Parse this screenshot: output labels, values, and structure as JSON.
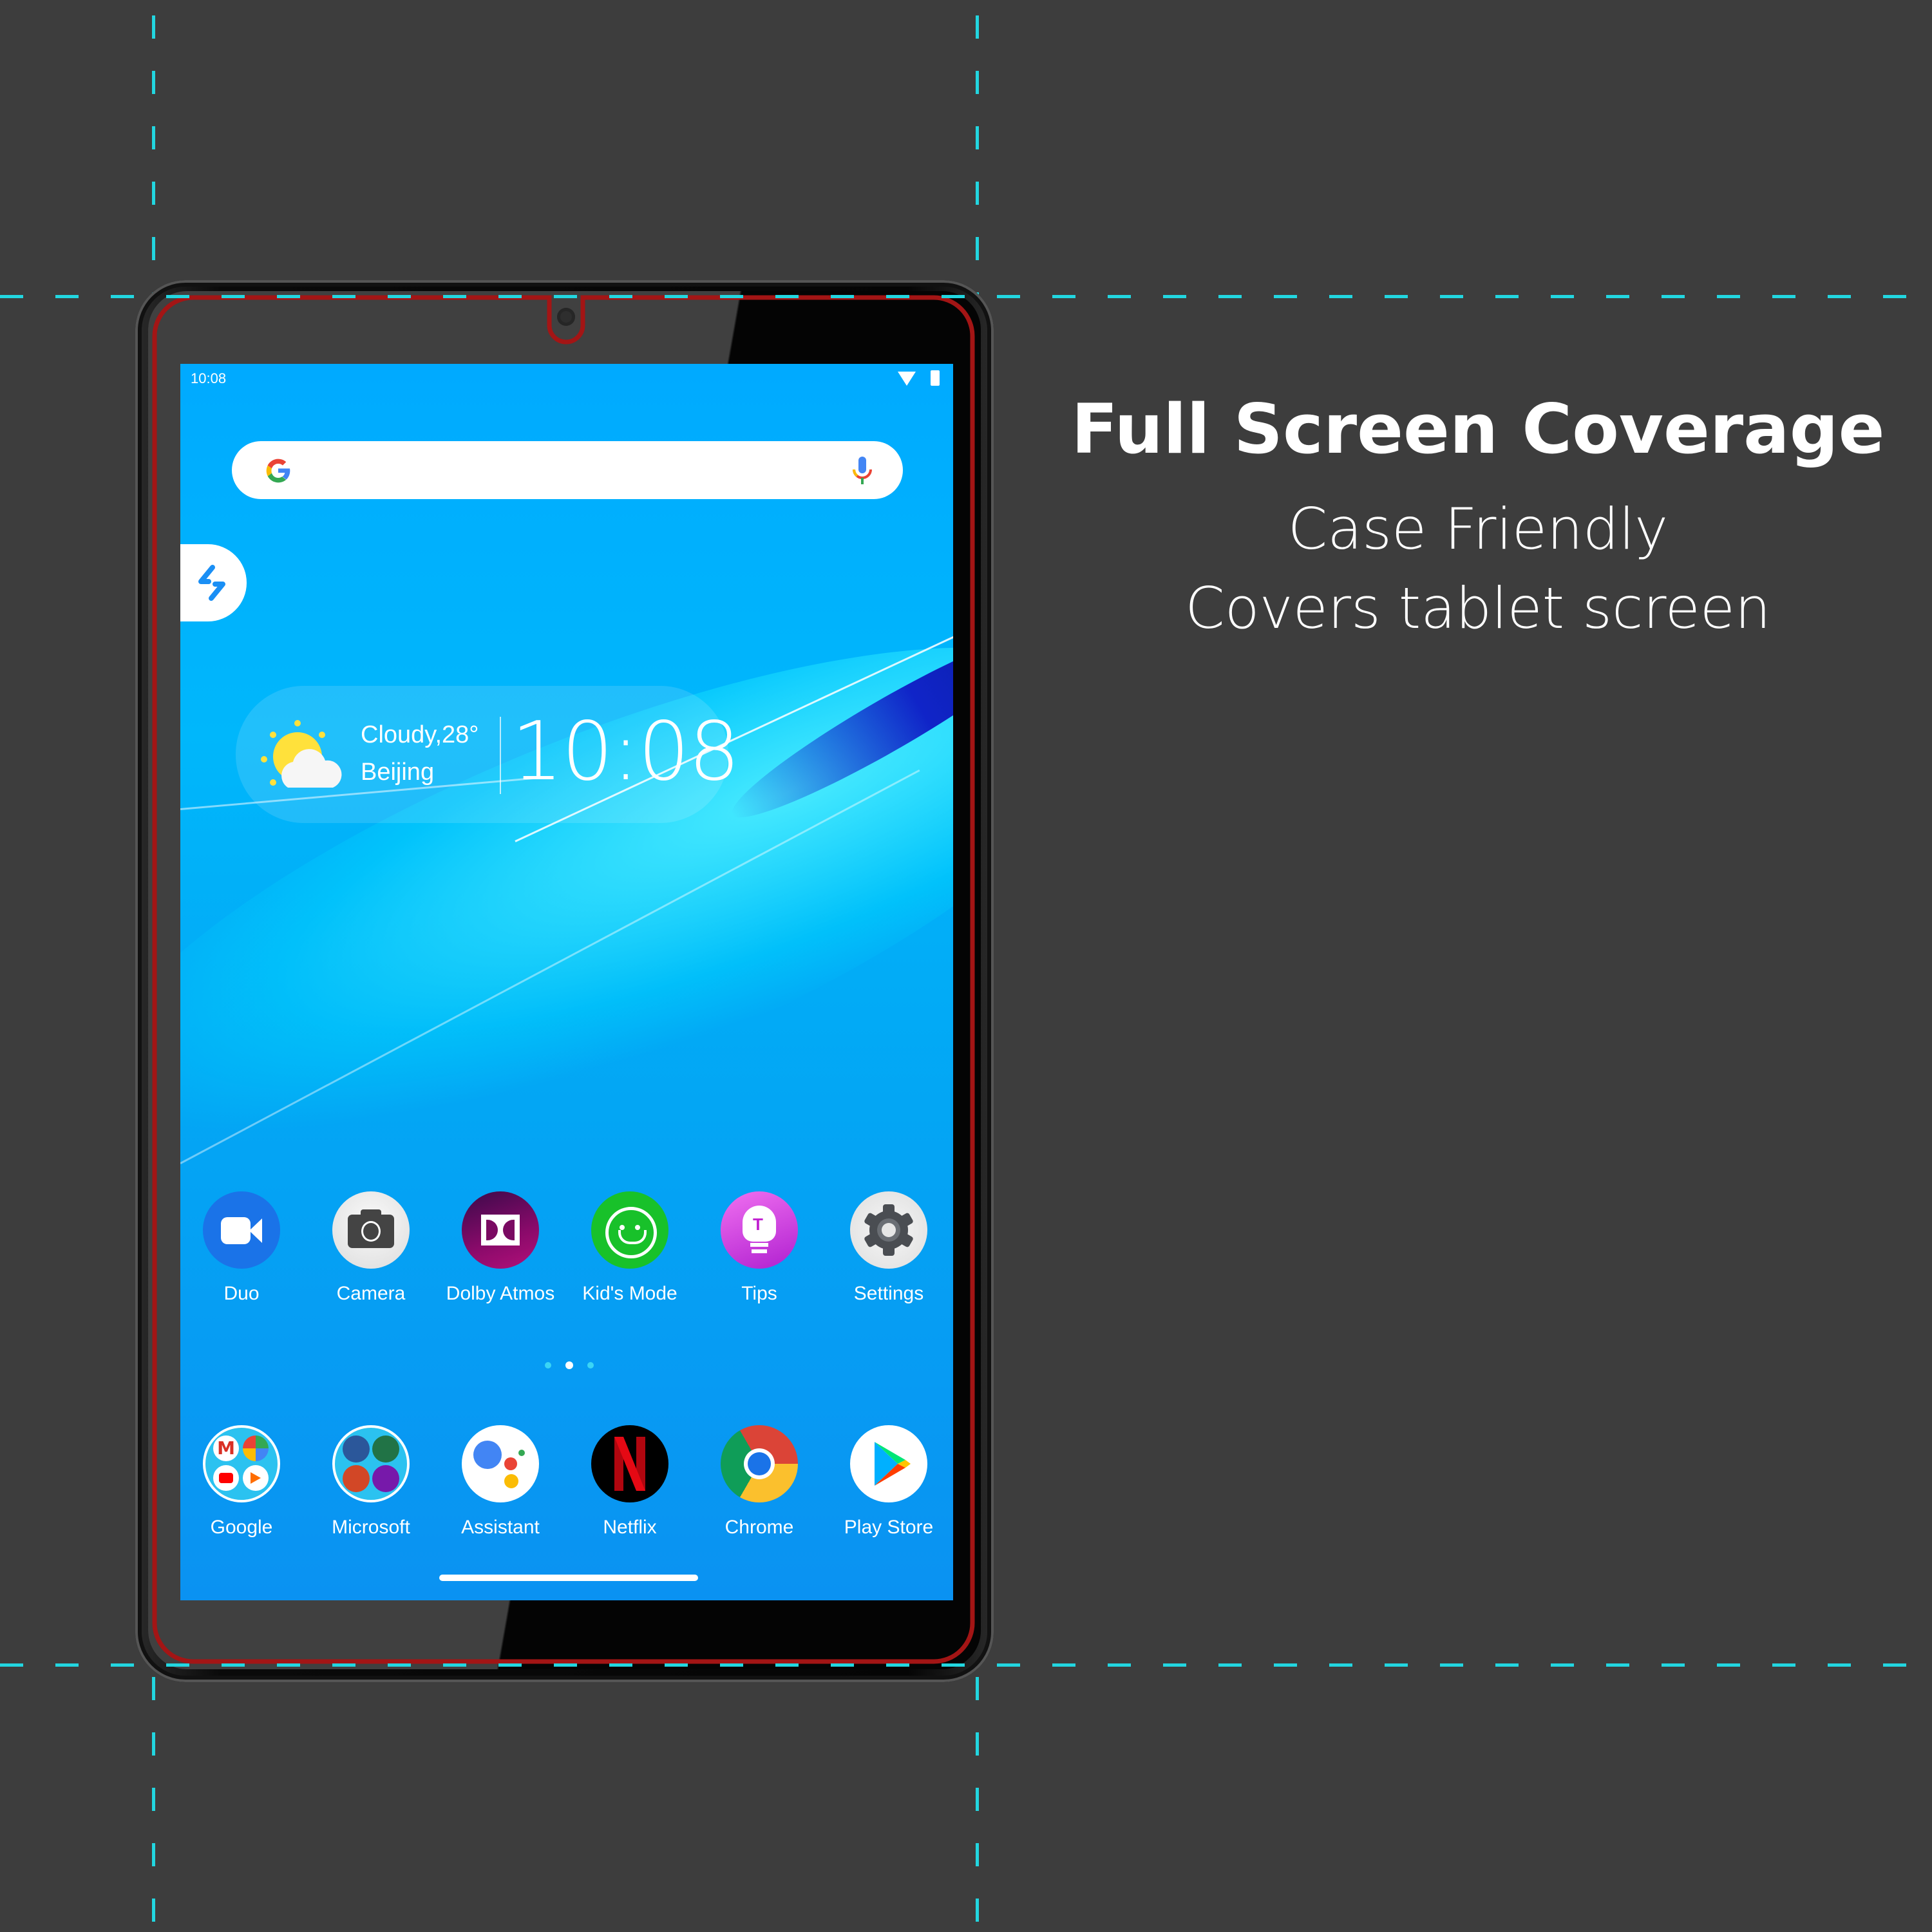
{
  "promo": {
    "headline": "Full Screen Coverage",
    "features": [
      "Case Friendly",
      "Covers tablet screen"
    ]
  },
  "colors": {
    "background": "#3d3d3d",
    "guide_lines": "#22d6e0",
    "coverage_outline": "#a31515",
    "wallpaper": "#00b4fb"
  },
  "tablet": {
    "status_bar": {
      "time": "10:08",
      "icons": [
        "wifi-icon",
        "battery-icon"
      ]
    },
    "search_bar": {
      "logo": "google-g-icon",
      "voice": "microphone-icon"
    },
    "side_panel": {
      "icon": "smart-side-bar-icon"
    },
    "weather_widget": {
      "condition": "Cloudy,28°",
      "city": "Beijing",
      "clock": "10:08",
      "icon": "partly-cloudy-icon"
    },
    "apps_row1": [
      {
        "label": "Duo",
        "icon": "duo-video-icon"
      },
      {
        "label": "Camera",
        "icon": "camera-icon"
      },
      {
        "label": "Dolby Atmos",
        "icon": "dolby-icon"
      },
      {
        "label": "Kid's Mode",
        "icon": "kids-mode-icon"
      },
      {
        "label": "Tips",
        "icon": "tips-bulb-icon"
      },
      {
        "label": "Settings",
        "icon": "settings-gear-icon"
      }
    ],
    "page_indicator": {
      "pages": 3,
      "current": 2
    },
    "apps_row2": [
      {
        "label": "Google",
        "icon": "google-folder-icon"
      },
      {
        "label": "Microsoft",
        "icon": "microsoft-folder-icon"
      },
      {
        "label": "Assistant",
        "icon": "assistant-icon"
      },
      {
        "label": "Netflix",
        "icon": "netflix-icon"
      },
      {
        "label": "Chrome",
        "icon": "chrome-icon"
      },
      {
        "label": "Play Store",
        "icon": "play-store-icon"
      }
    ]
  }
}
